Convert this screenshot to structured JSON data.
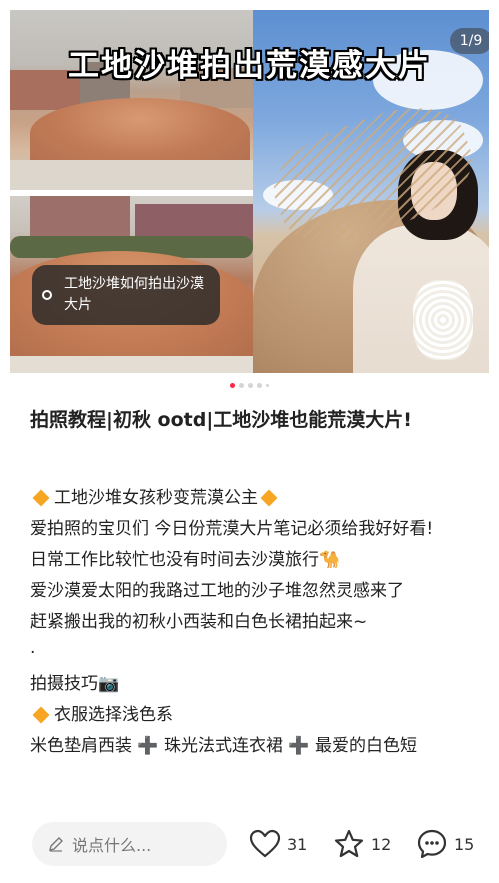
{
  "media": {
    "overlay_title": "工地沙堆拍出荒漠感大片",
    "page_indicator": "1/9",
    "tag_text": "工地沙堆如何拍出沙漠大片"
  },
  "pager": {
    "current": 1,
    "total_dots_visible": 5
  },
  "post": {
    "title": "拍照教程|初秋 ootd|工地沙堆也能荒漠大片!",
    "lines": [
      "工地沙堆女孩秒变荒漠公主",
      "爱拍照的宝贝们 今日份荒漠大片笔记必须给我好好看!",
      "日常工作比较忙也没有时间去沙漠旅行",
      "爱沙漠爱太阳的我路过工地的沙子堆忽然灵感来了",
      "赶紧搬出我的初秋小西装和白色长裙拍起来~",
      "·",
      "拍摄技巧",
      "衣服选择浅色系",
      "米色垫肩西装 ➕ 珠光法式连衣裙 ➕ 最爱的白色短"
    ],
    "emoji": {
      "travel": "🐪",
      "camera": "📷"
    }
  },
  "bottom_bar": {
    "comment_placeholder": "说点什么...",
    "like_count": "31",
    "favorite_count": "12",
    "comment_count": "15"
  },
  "colors": {
    "accent": "#ff2442",
    "diamond": "#f6a623"
  },
  "icons": [
    "pencil-icon",
    "heart-icon",
    "star-icon",
    "comment-bubble-icon"
  ]
}
